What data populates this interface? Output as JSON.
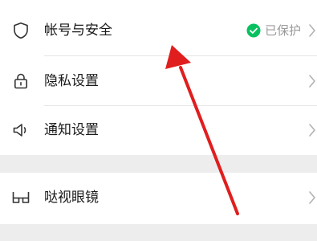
{
  "settings": {
    "account_security": {
      "label": "帐号与安全",
      "status": "已保护",
      "icon": "shield-icon",
      "status_icon": "check-circle-icon",
      "status_color": "#07c160"
    },
    "privacy": {
      "label": "隐私设置",
      "icon": "lock-icon"
    },
    "notifications": {
      "label": "通知设置",
      "icon": "speaker-icon"
    },
    "glasses": {
      "label": "哒视眼镜",
      "icon": "glasses-icon"
    }
  },
  "colors": {
    "background": "#ededed",
    "row_background": "#ffffff",
    "annotation_arrow": "#e01e1e"
  }
}
